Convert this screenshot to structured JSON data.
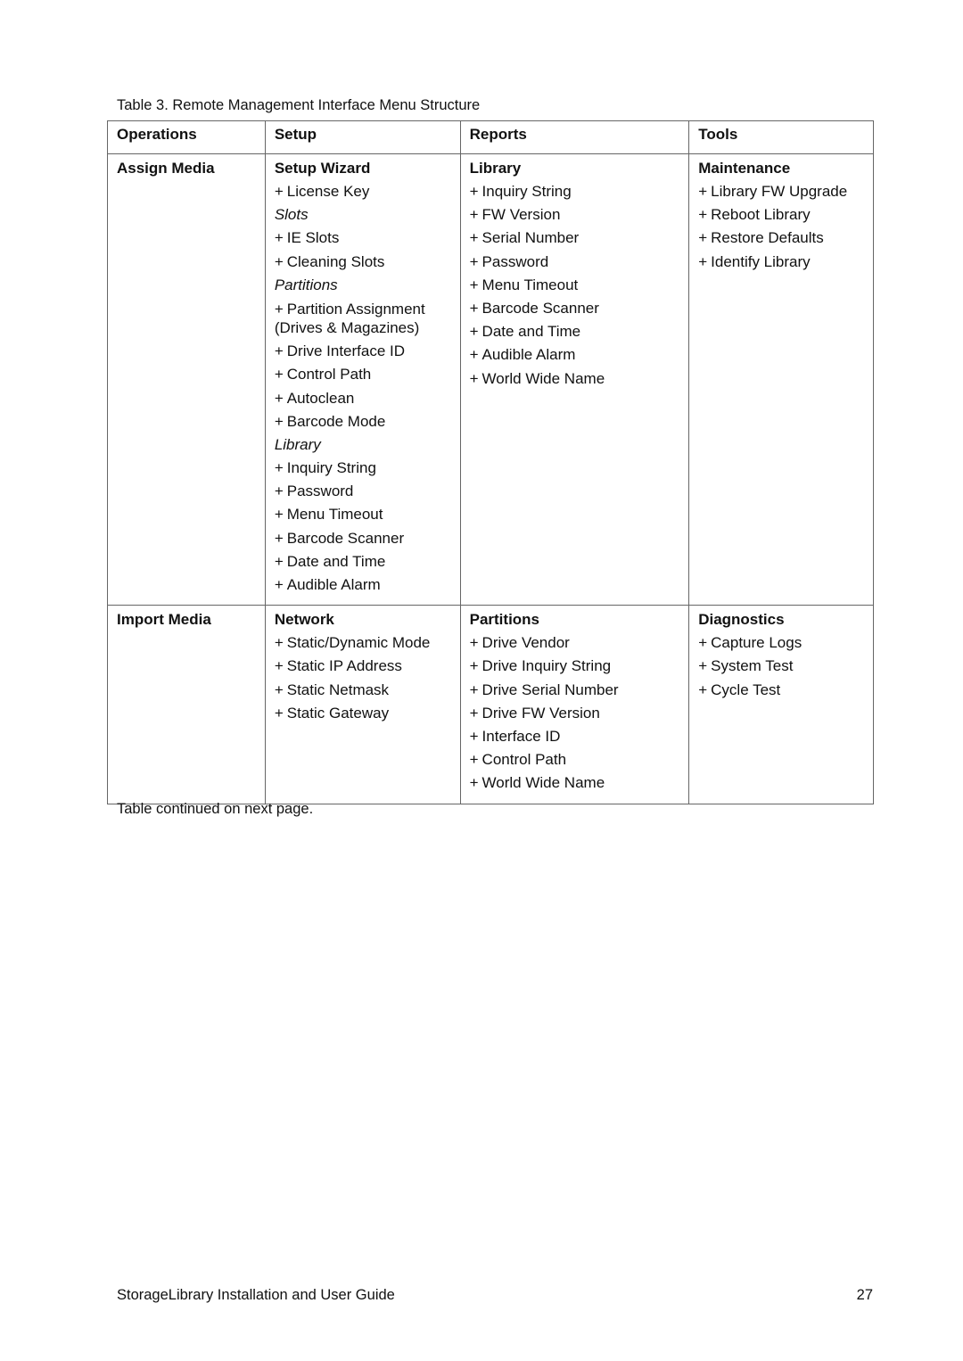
{
  "caption": "Table 3. Remote Management Interface Menu Structure",
  "headers": [
    "Operations",
    "Setup",
    "Reports",
    "Tools"
  ],
  "rows": [
    {
      "operations": {
        "group": "Assign Media"
      },
      "setup": {
        "group": "Setup Wizard",
        "entries": [
          {
            "type": "item",
            "text": "License Key"
          },
          {
            "type": "sub",
            "text": "Slots"
          },
          {
            "type": "item",
            "text": "IE Slots"
          },
          {
            "type": "item",
            "text": "Cleaning Slots"
          },
          {
            "type": "sub",
            "text": "Partitions"
          },
          {
            "type": "item",
            "text": "Partition Assignment (Drives & Magazines)"
          },
          {
            "type": "item",
            "text": "Drive Interface ID"
          },
          {
            "type": "item",
            "text": "Control Path"
          },
          {
            "type": "item",
            "text": "Autoclean"
          },
          {
            "type": "item",
            "text": "Barcode Mode"
          },
          {
            "type": "sub",
            "text": "Library"
          },
          {
            "type": "item",
            "text": "Inquiry String"
          },
          {
            "type": "item",
            "text": "Password"
          },
          {
            "type": "item",
            "text": "Menu Timeout"
          },
          {
            "type": "item",
            "text": "Barcode Scanner"
          },
          {
            "type": "item",
            "text": "Date and Time"
          },
          {
            "type": "item",
            "text": "Audible Alarm"
          }
        ]
      },
      "reports": {
        "group": "Library",
        "entries": [
          {
            "type": "item",
            "text": "Inquiry String"
          },
          {
            "type": "item",
            "text": "FW Version"
          },
          {
            "type": "item",
            "text": "Serial Number"
          },
          {
            "type": "item",
            "text": "Password"
          },
          {
            "type": "item",
            "text": "Menu Timeout"
          },
          {
            "type": "item",
            "text": "Barcode Scanner"
          },
          {
            "type": "item",
            "text": "Date and Time"
          },
          {
            "type": "item",
            "text": "Audible Alarm"
          },
          {
            "type": "item",
            "text": "World Wide Name"
          }
        ]
      },
      "tools": {
        "group": "Maintenance",
        "entries": [
          {
            "type": "item",
            "text": "Library FW Upgrade"
          },
          {
            "type": "item",
            "text": "Reboot Library"
          },
          {
            "type": "item",
            "text": "Restore Defaults"
          },
          {
            "type": "item",
            "text": "Identify Library"
          }
        ]
      }
    },
    {
      "operations": {
        "group": "Import Media"
      },
      "setup": {
        "group": "Network",
        "entries": [
          {
            "type": "item",
            "text": "Static/Dynamic Mode"
          },
          {
            "type": "item",
            "text": "Static IP Address"
          },
          {
            "type": "item",
            "text": "Static Netmask"
          },
          {
            "type": "item",
            "text": "Static Gateway"
          }
        ]
      },
      "reports": {
        "group": "Partitions",
        "entries": [
          {
            "type": "item",
            "text": "Drive Vendor"
          },
          {
            "type": "item",
            "text": "Drive Inquiry String"
          },
          {
            "type": "item",
            "text": "Drive Serial Number"
          },
          {
            "type": "item",
            "text": "Drive FW Version"
          },
          {
            "type": "item",
            "text": "Interface ID"
          },
          {
            "type": "item",
            "text": "Control Path"
          },
          {
            "type": "item",
            "text": "World Wide Name"
          }
        ]
      },
      "tools": {
        "group": "Diagnostics",
        "entries": [
          {
            "type": "item",
            "text": "Capture Logs"
          },
          {
            "type": "item",
            "text": "System Test"
          },
          {
            "type": "item",
            "text": "Cycle Test"
          }
        ]
      }
    }
  ],
  "item_prefix": "+",
  "continued_note": "Table continued on next page.",
  "footer": {
    "title": "StorageLibrary Installation and User Guide",
    "page_number": "27"
  }
}
